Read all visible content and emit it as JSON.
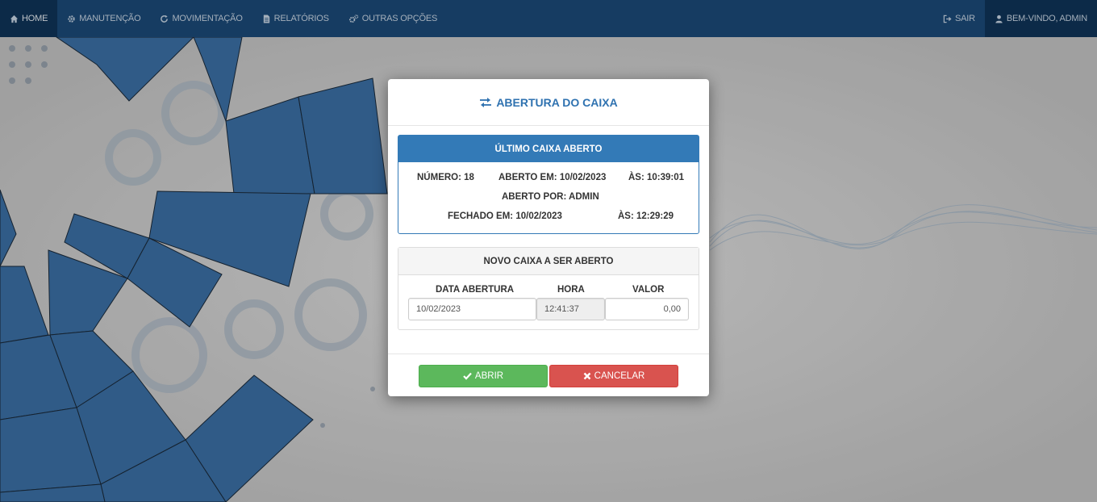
{
  "navbar": {
    "home": "HOME",
    "manutencao": "MANUTENÇÃO",
    "movimentacao": "MOVIMENTAÇÃO",
    "relatorios": "RELATÓRIOS",
    "outras_opcoes": "OUTRAS OPÇÕES",
    "sair": "SAIR",
    "welcome": "BEM-VINDO, ADMIN"
  },
  "modal": {
    "title": "ABERTURA DO CAIXA",
    "ultimo_caixa": {
      "heading": "ÚLTIMO CAIXA ABERTO",
      "numero": "NÚMERO: 18",
      "aberto_em": "ABERTO EM: 10/02/2023",
      "aberto_as": "ÀS: 10:39:01",
      "aberto_por": "ABERTO POR: ADMIN",
      "fechado_em": "FECHADO EM: 10/02/2023",
      "fechado_as": "ÀS: 12:29:29"
    },
    "novo_caixa": {
      "heading": "NOVO CAIXA A SER ABERTO",
      "data_label": "DATA ABERTURA",
      "data_value": "10/02/2023",
      "hora_label": "HORA",
      "hora_value": "12:41:37",
      "valor_label": "VALOR",
      "valor_value": "0,00"
    },
    "abrir_label": "ABRIR",
    "cancelar_label": "CANCELAR"
  },
  "colors": {
    "navbar": "#1b4a78",
    "primary": "#337ab7",
    "success": "#5cb85c",
    "danger": "#d9534f"
  }
}
